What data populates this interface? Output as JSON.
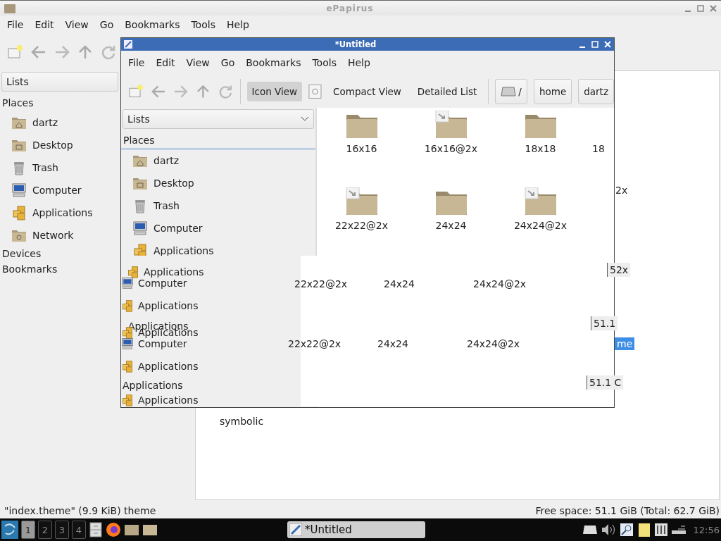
{
  "back_window": {
    "title": "ePapirus",
    "menu": [
      "File",
      "Edit",
      "View",
      "Go",
      "Bookmarks",
      "Tools",
      "Help"
    ],
    "sidebar": {
      "dropdown": "Lists",
      "heading": "Places",
      "places": [
        {
          "label": "dartz",
          "kind": "home"
        },
        {
          "label": "Desktop",
          "kind": "desktop"
        },
        {
          "label": "Trash",
          "kind": "trash"
        },
        {
          "label": "Computer",
          "kind": "computer"
        },
        {
          "label": "Applications",
          "kind": "apps"
        },
        {
          "label": "Network",
          "kind": "network"
        }
      ],
      "sections": [
        "Devices",
        "Bookmarks"
      ]
    },
    "peek_labels": [
      {
        "text": "2x",
        "selected": false
      },
      {
        "text": "me",
        "selected": true
      }
    ],
    "bottom_item": "symbolic",
    "status": {
      "left": "\"index.theme\" (9.9 KiB) theme",
      "right": "Free space: 51.1 GiB (Total: 62.7 GiB)"
    }
  },
  "front_window": {
    "title": "*Untitled",
    "menu": [
      "File",
      "Edit",
      "View",
      "Go",
      "Bookmarks",
      "Tools",
      "Help"
    ],
    "views": [
      {
        "label": "Icon View",
        "selected": true
      },
      {
        "label": "Compact View",
        "selected": false
      },
      {
        "label": "Detailed List",
        "selected": false
      }
    ],
    "path": [
      {
        "label": "/",
        "kind": "drive"
      },
      {
        "label": "home",
        "kind": "text"
      },
      {
        "label": "dartz",
        "kind": "text"
      }
    ],
    "sidebar": {
      "dropdown": "Lists",
      "heading": "Places",
      "items": [
        {
          "label": "dartz",
          "kind": "home"
        },
        {
          "label": "Desktop",
          "kind": "desktop"
        },
        {
          "label": "Trash",
          "kind": "trash"
        },
        {
          "label": "Computer",
          "kind": "computer"
        },
        {
          "label": "Applications",
          "kind": "apps"
        }
      ]
    },
    "grid": [
      {
        "label": "16x16",
        "kind": "folder"
      },
      {
        "label": "16x16@2x",
        "kind": "link"
      },
      {
        "label": "18x18",
        "kind": "folder"
      },
      {
        "label": "18",
        "kind": "partial"
      },
      {
        "label": "22x22@2x",
        "kind": "link"
      },
      {
        "label": "24x24",
        "kind": "folder"
      },
      {
        "label": "24x24@2x",
        "kind": "link"
      }
    ],
    "glitch": {
      "sidebar_fragments": [
        {
          "text": "Applications",
          "kind": "apps"
        },
        {
          "text": "Computer",
          "kind": "computer"
        },
        {
          "text": "Applications",
          "kind": "apps"
        },
        {
          "text": "Applications",
          "kind": "none"
        },
        {
          "text": "Applications",
          "kind": "apps"
        },
        {
          "text": "Computer",
          "kind": "computer"
        },
        {
          "text": "Applications",
          "kind": "apps"
        },
        {
          "text": "Applications",
          "kind": "none"
        },
        {
          "text": "Applications",
          "kind": "apps"
        }
      ],
      "label_rows": [
        [
          "22x22@2x",
          "24x24",
          "24x24@2x"
        ],
        [
          "22x22@2x",
          "24x24",
          "24x24@2x"
        ]
      ],
      "edge_fragments": [
        "52x",
        "51.1",
        "51.1 C"
      ]
    }
  },
  "taskbar": {
    "workspaces": [
      {
        "label": "1",
        "selected": true
      },
      {
        "label": "2",
        "selected": false
      },
      {
        "label": "3",
        "selected": false
      },
      {
        "label": "4",
        "selected": false
      }
    ],
    "task": "*Untitled",
    "clock": "12:56"
  }
}
